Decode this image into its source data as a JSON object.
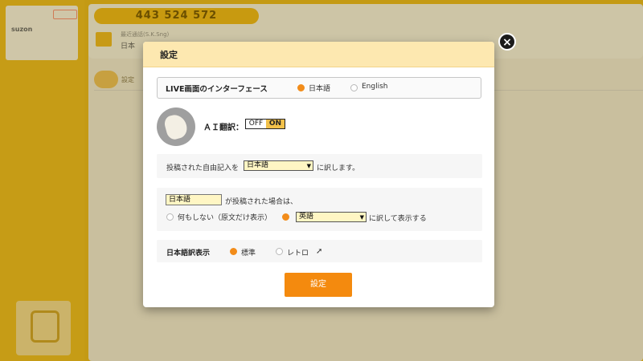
{
  "background": {
    "logo_text": "suzon",
    "phone_number": "443 524 572",
    "info_line1": "最近通話(S.K.Sng)",
    "info_line2": "日本",
    "section_label": "設定"
  },
  "modal": {
    "title": "設定",
    "close_icon": "×",
    "interface": {
      "label": "LIVE画面のインターフェース",
      "options": [
        {
          "label": "日本語",
          "selected": true
        },
        {
          "label": "English",
          "selected": false
        }
      ]
    },
    "ai_translation": {
      "label": "ＡＩ翻訳：",
      "off_label": "OFF",
      "on_label": "ON",
      "state": "ON"
    },
    "free_text": {
      "prefix": "投稿された自由記入を",
      "selected": "日本語",
      "suffix": "に訳します。"
    },
    "posted": {
      "input_value": "日本語",
      "suffix": "が投稿された場合は、",
      "option_none": "何もしない（原文だけ表示）",
      "selected_lang": "英語",
      "option_translate_suffix": "に訳して表示する",
      "selected_option": "translate"
    },
    "display": {
      "label": "日本語訳表示",
      "options": [
        {
          "label": "標準",
          "selected": true
        },
        {
          "label": "レトロ",
          "selected": false
        }
      ]
    },
    "submit_label": "設定"
  },
  "colors": {
    "accent": "#f48a0e",
    "header_bg": "#fde8b0",
    "page_bg": "#c49a14"
  }
}
